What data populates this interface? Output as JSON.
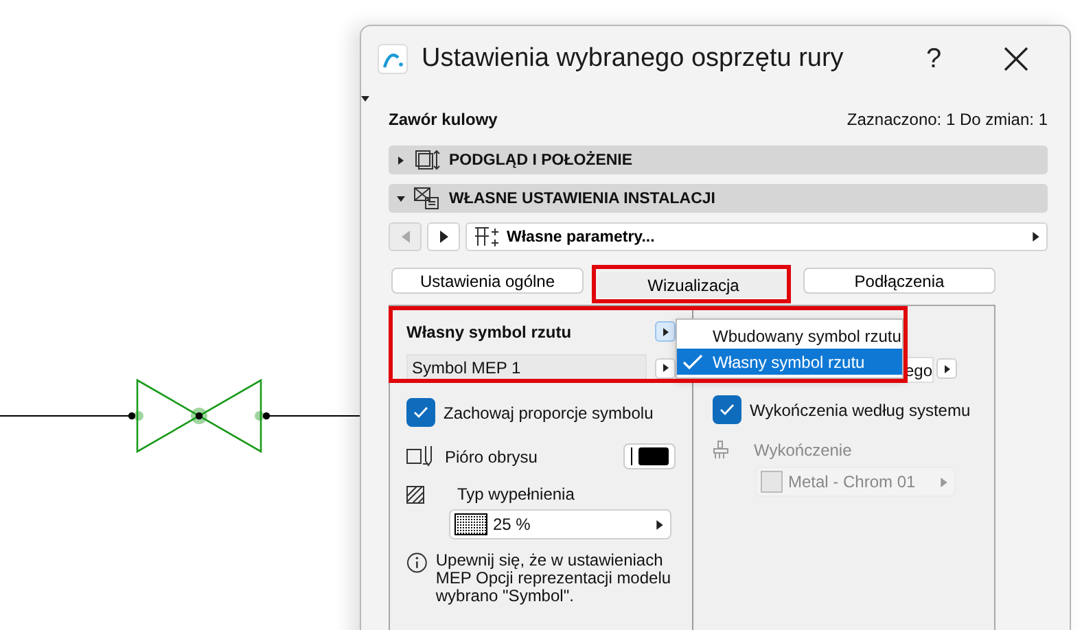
{
  "window": {
    "title": "Ustawienia wybranego osprzętu rury",
    "help": "?"
  },
  "element": {
    "name": "Zawór kulowy",
    "status": "Zaznaczono: 1 Do zmian: 1"
  },
  "sections": [
    {
      "label": "PODGLĄD I POŁOŻENIE",
      "expanded": false
    },
    {
      "label": "WŁASNE USTAWIENIA INSTALACJI",
      "expanded": true
    }
  ],
  "nav": {
    "page": "Własne parametry..."
  },
  "tabs": [
    {
      "label": "Ustawienia ogólne",
      "selected": false
    },
    {
      "label": "Wizualizacja",
      "selected": true
    },
    {
      "label": "Podłączenia",
      "selected": false
    }
  ],
  "symbol": {
    "label": "Własny symbol rzutu",
    "value": "Symbol MEP 1"
  },
  "menu": [
    {
      "label": "Wbudowany symbol rzutu",
      "checked": false
    },
    {
      "label": "Własny symbol rzutu",
      "checked": true
    }
  ],
  "right_field": {
    "value": "ego"
  },
  "left": {
    "keep_proportions": {
      "label": "Zachowaj proporcje symbolu",
      "checked": true
    },
    "pen": {
      "label": "Pióro obrysu"
    },
    "fill": {
      "label": "Typ wypełnienia",
      "value": "25 %"
    },
    "note": "Upewnij się, że w ustawieniach MEP Opcji reprezentacji modelu wybrano \"Symbol\"."
  },
  "right": {
    "by_system": {
      "label": "Wykończenia według systemu",
      "checked": true
    },
    "surface": {
      "label": "Wykończenie",
      "value": "Metal - Chrom 01",
      "disabled": true
    }
  }
}
